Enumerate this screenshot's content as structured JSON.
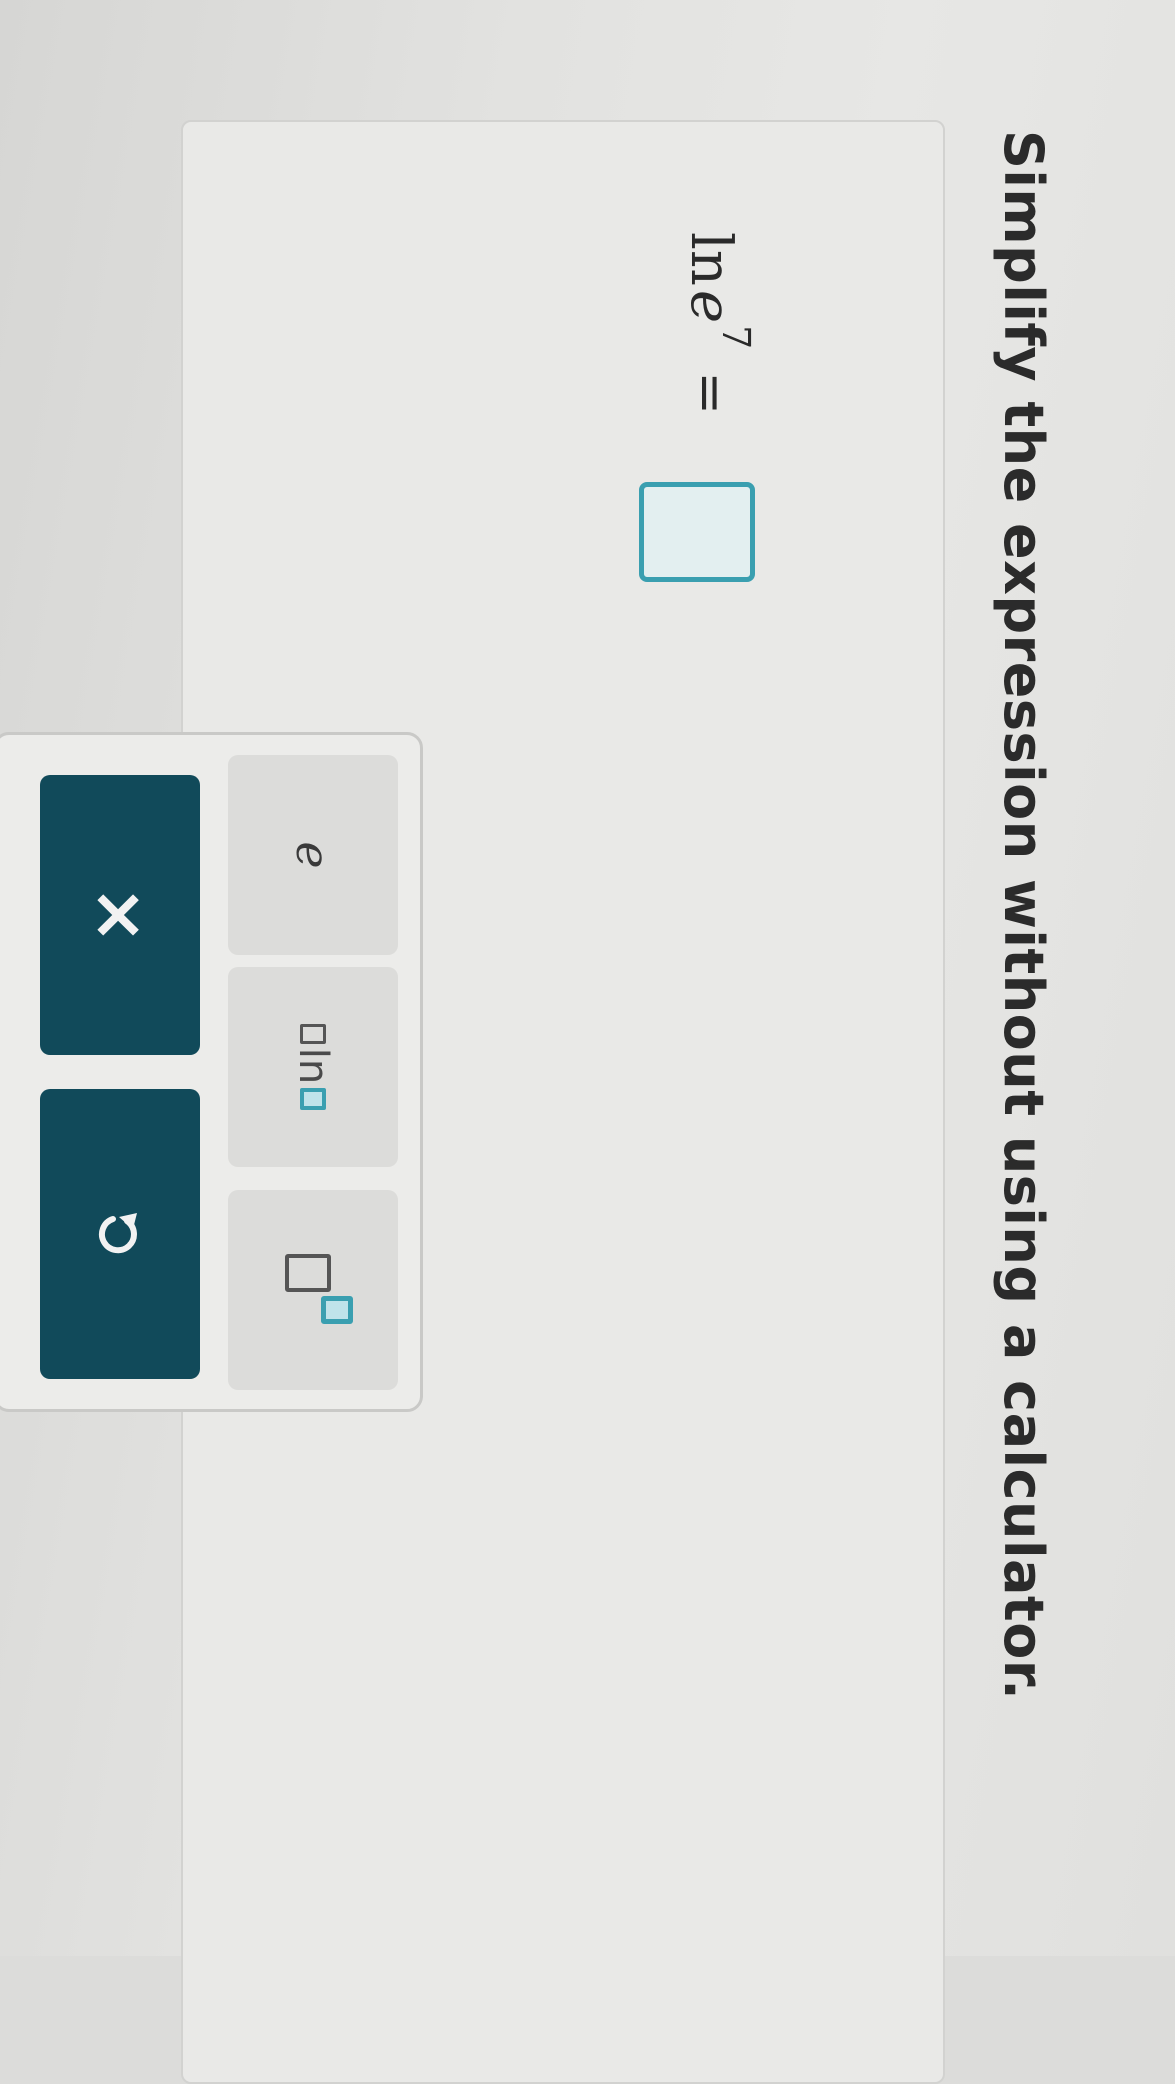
{
  "question": {
    "title": "Simplify the expression without using a calculator."
  },
  "expression": {
    "function": "ln",
    "base": "e",
    "exponent": "7",
    "equals": "="
  },
  "answer": {
    "value": ""
  },
  "keypad": {
    "keys": [
      {
        "label": "e",
        "icon": "e-constant"
      },
      {
        "label": "ln",
        "icon": "natural-log-template"
      },
      {
        "label": "",
        "icon": "exponent-template"
      }
    ],
    "clear_label": "×",
    "undo_icon": "undo-icon"
  },
  "colors": {
    "accent": "#3a9fb0",
    "dark_button": "#114a5a",
    "panel": "#e9e9e7"
  }
}
